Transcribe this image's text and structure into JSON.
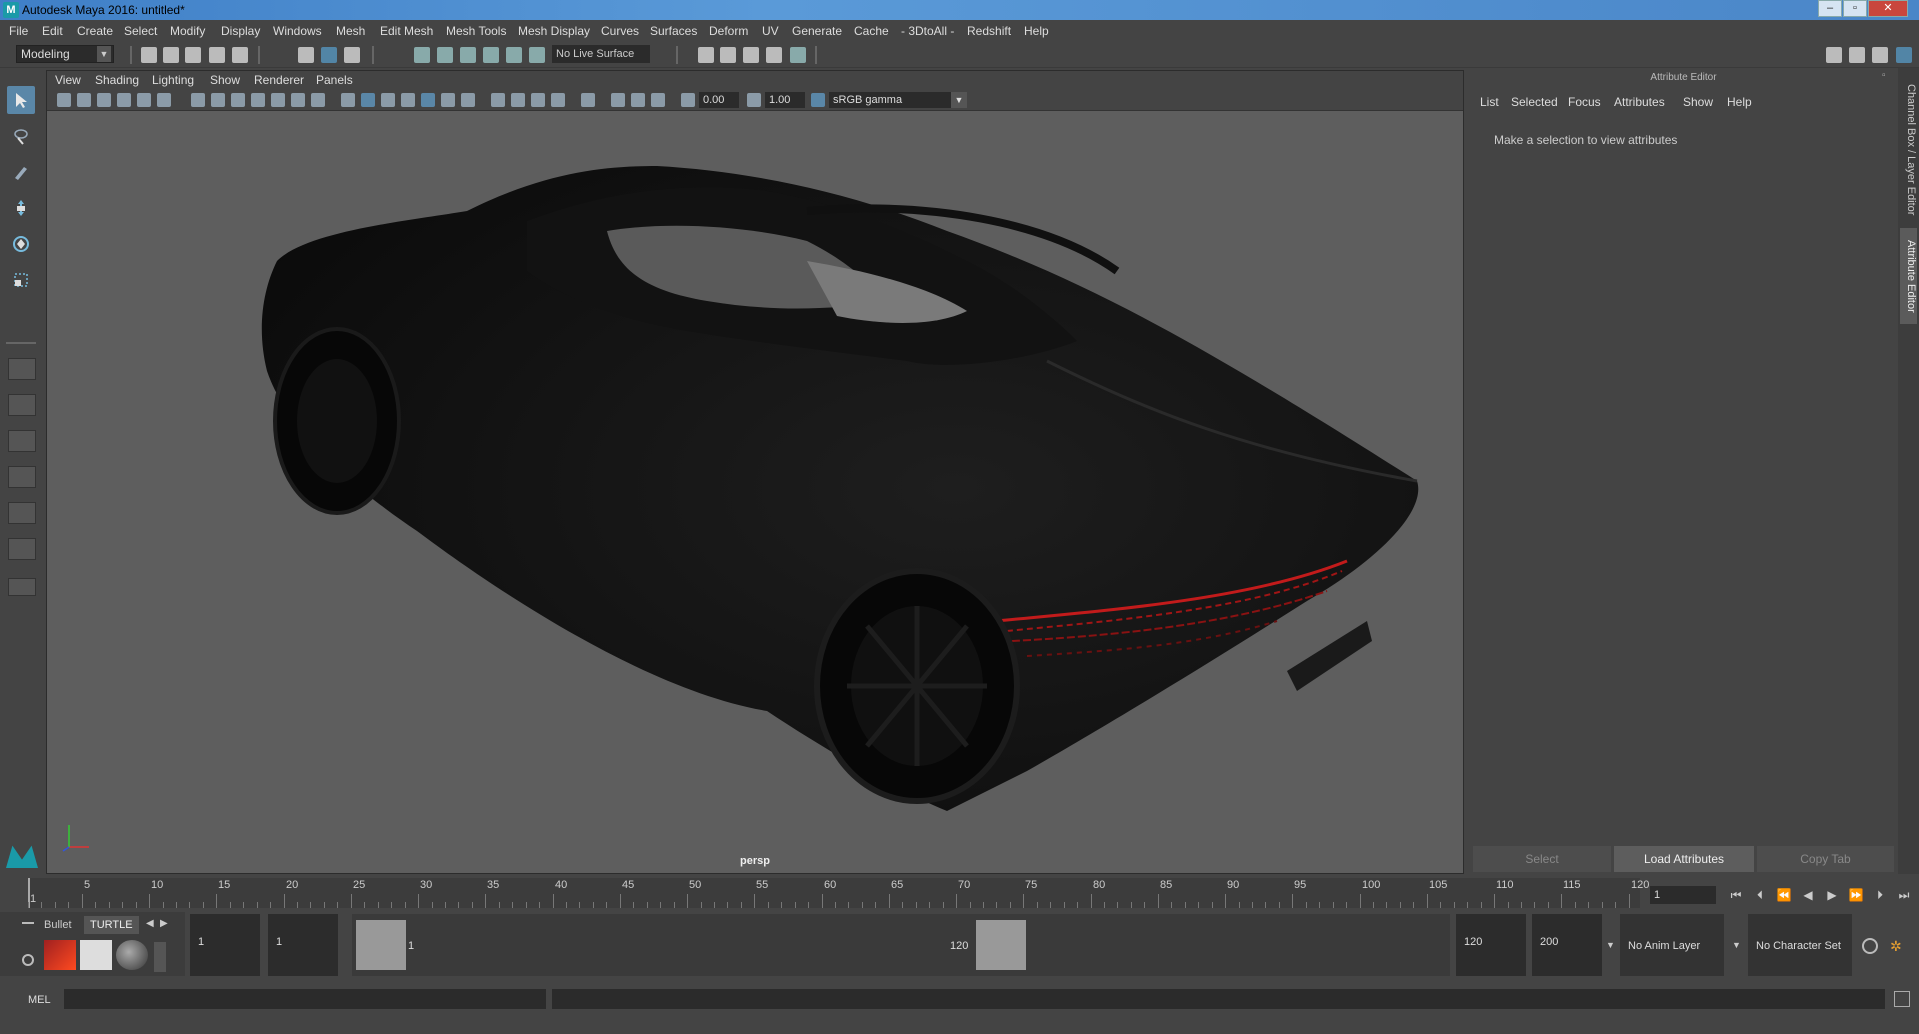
{
  "window": {
    "title": "Autodesk Maya 2016: untitled*"
  },
  "menubar": [
    "File",
    "Edit",
    "Create",
    "Select",
    "Modify",
    "Display",
    "Windows",
    "Mesh",
    "Edit Mesh",
    "Mesh Tools",
    "Mesh Display",
    "Curves",
    "Surfaces",
    "Deform",
    "UV",
    "Generate",
    "Cache",
    "- 3DtoAll -",
    "Redshift",
    "Help"
  ],
  "toolbar": {
    "mode": "Modeling",
    "live_surface": "No Live Surface"
  },
  "viewport": {
    "menu": [
      "View",
      "Shading",
      "Lighting",
      "Show",
      "Renderer",
      "Panels"
    ],
    "exposure": "0.00",
    "gamma": "1.00",
    "color_space": "sRGB gamma",
    "camera_label": "persp"
  },
  "attribute_editor": {
    "title": "Attribute Editor",
    "menu": [
      "List",
      "Selected",
      "Focus",
      "Attributes",
      "Show",
      "Help"
    ],
    "message": "Make a selection to view attributes",
    "buttons": [
      "Select",
      "Load Attributes",
      "Copy Tab"
    ]
  },
  "side_tabs": [
    "Channel Box / Layer Editor",
    "Attribute Editor"
  ],
  "timeline": {
    "ticks": [
      "1",
      "5",
      "10",
      "15",
      "20",
      "25",
      "30",
      "35",
      "40",
      "45",
      "50",
      "55",
      "60",
      "65",
      "70",
      "75",
      "80",
      "85",
      "90",
      "95",
      "100",
      "105",
      "110",
      "115",
      "120"
    ],
    "current_frame": "1"
  },
  "shelf": {
    "tabs": [
      "Bullet",
      "TURTLE"
    ]
  },
  "range": {
    "start": "1",
    "playback_start": "1",
    "range_start_label": "1",
    "range_end_label": "120",
    "playback_end": "120",
    "end": "200",
    "anim_layer": "No Anim Layer",
    "character_set": "No Character Set"
  },
  "command_line": {
    "language": "MEL"
  }
}
